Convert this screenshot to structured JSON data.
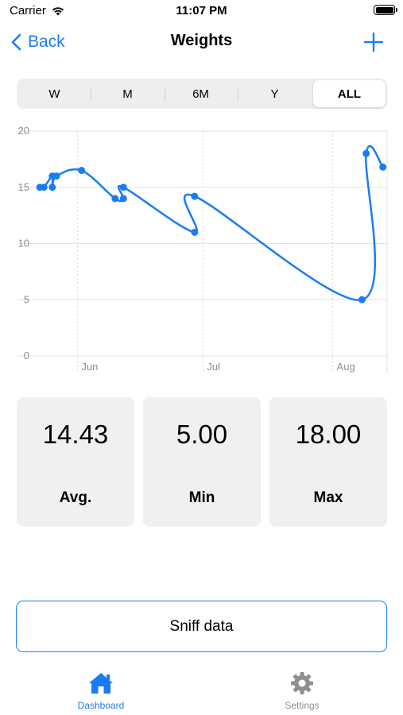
{
  "status_bar": {
    "carrier": "Carrier",
    "time": "11:07 PM"
  },
  "nav": {
    "back_label": "Back",
    "title": "Weights"
  },
  "colors": {
    "accent": "#1a7cf5",
    "card_bg": "#f0f0f3",
    "segment_bg": "#eeeef0"
  },
  "segments": [
    {
      "label": "W",
      "selected": false
    },
    {
      "label": "M",
      "selected": false
    },
    {
      "label": "6M",
      "selected": false
    },
    {
      "label": "Y",
      "selected": false
    },
    {
      "label": "ALL",
      "selected": true
    }
  ],
  "chart_data": {
    "type": "line",
    "x_ticks": [
      "Jun",
      "Jul",
      "Aug"
    ],
    "y_ticks": [
      0,
      5,
      10,
      15,
      20
    ],
    "ylim": [
      0,
      20
    ],
    "xlim": [
      "2023-05-23",
      "2023-08-14"
    ],
    "x_tick_dates": [
      "2023-06-01",
      "2023-07-01",
      "2023-08-01"
    ],
    "grid": true,
    "series": [
      {
        "points": [
          {
            "x": "2023-05-23",
            "y": 15.0
          },
          {
            "x": "2023-05-24",
            "y": 15.0
          },
          {
            "x": "2023-05-26",
            "y": 16.0
          },
          {
            "x": "2023-05-26",
            "y": 15.0
          },
          {
            "x": "2023-05-27",
            "y": 16.0
          },
          {
            "x": "2023-06-02",
            "y": 16.5
          },
          {
            "x": "2023-06-10",
            "y": 14.0
          },
          {
            "x": "2023-06-12",
            "y": 14.0
          },
          {
            "x": "2023-06-12",
            "y": 15.0
          },
          {
            "x": "2023-06-29",
            "y": 11.0
          },
          {
            "x": "2023-06-29",
            "y": 14.2
          },
          {
            "x": "2023-08-08",
            "y": 5.0
          },
          {
            "x": "2023-08-09",
            "y": 18.0
          },
          {
            "x": "2023-08-13",
            "y": 16.8
          }
        ]
      }
    ]
  },
  "stats": [
    {
      "value": "14.43",
      "label": "Avg."
    },
    {
      "value": "5.00",
      "label": "Min"
    },
    {
      "value": "18.00",
      "label": "Max"
    }
  ],
  "sniff_button": {
    "label": "Sniff data"
  },
  "tabbar": [
    {
      "label": "Dashboard",
      "icon": "house-icon",
      "active": true
    },
    {
      "label": "Settings",
      "icon": "gear-icon",
      "active": false
    }
  ]
}
